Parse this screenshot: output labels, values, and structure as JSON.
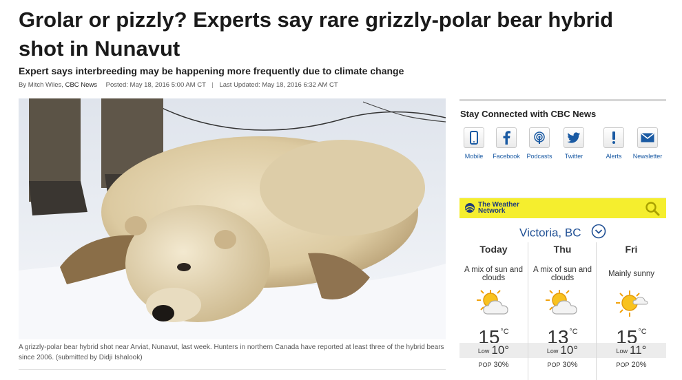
{
  "article": {
    "headline": "Grolar or pizzly? Experts say rare grizzly-polar bear hybrid shot in Nunavut",
    "subheadline": "Expert says interbreeding may be happening more frequently due to climate change",
    "byline": {
      "by_prefix": "By Mitch Wiles,",
      "outlet": "CBC News",
      "posted": "Posted: May 18, 2016 5:00 AM CT",
      "separator": "|",
      "updated": "Last Updated: May 18, 2016 6:32 AM CT"
    },
    "caption": "A grizzly-polar bear hybrid shot near Arviat, Nunavut, last week. Hunters in northern Canada have reported at least three of the hybrid bears since 2006. (submitted by Didji Ishalook)"
  },
  "sidebar": {
    "stay_connected": {
      "title": "Stay Connected with CBC News",
      "items": [
        {
          "label": "Mobile",
          "icon": "mobile-phone-icon"
        },
        {
          "label": "Facebook",
          "icon": "facebook-icon"
        },
        {
          "label": "Podcasts",
          "icon": "podcast-icon"
        },
        {
          "label": "Twitter",
          "icon": "twitter-bird-icon"
        },
        {
          "label": "Alerts",
          "icon": "alert-exclamation-icon"
        },
        {
          "label": "Newsletter",
          "icon": "envelope-icon"
        }
      ]
    },
    "weather": {
      "brand": "The Weather Network",
      "city": "Victoria, BC",
      "low_label": "Low",
      "pop_label": "POP",
      "unit": "°C",
      "days": [
        {
          "day": "Today",
          "condition": "A mix of sun and clouds",
          "high": "15",
          "low": "10°",
          "pop": "30%",
          "icon": "sun-cloud-icon"
        },
        {
          "day": "Thu",
          "condition": "A mix of sun and clouds",
          "high": "13",
          "low": "10°",
          "pop": "30%",
          "icon": "sun-cloud-icon"
        },
        {
          "day": "Fri",
          "condition": "Mainly sunny",
          "high": "15",
          "low": "11°",
          "pop": "20%",
          "icon": "sun-small-cloud-icon"
        }
      ]
    }
  },
  "colors": {
    "weather_header": "#f5ee2e",
    "link_blue": "#1a5aa3",
    "city_blue": "#1f4f94"
  }
}
